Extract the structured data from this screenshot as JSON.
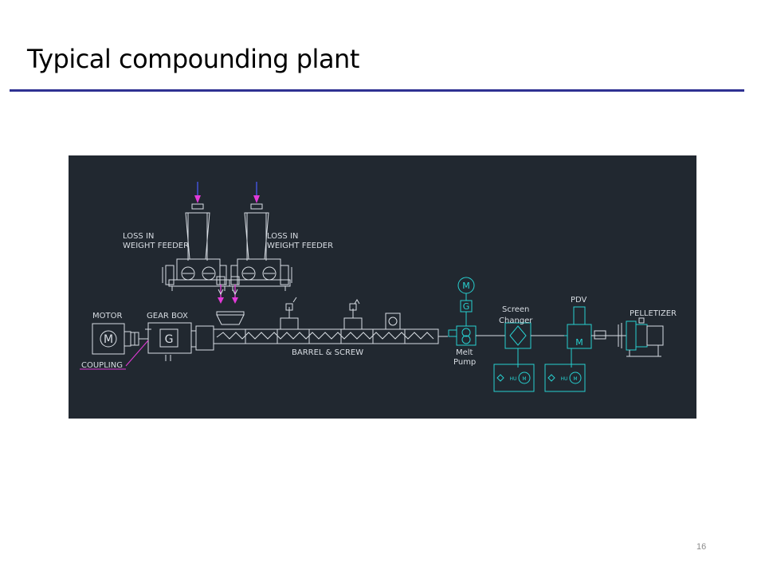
{
  "slide": {
    "title": "Typical compounding plant",
    "page_number": "16"
  },
  "diagram": {
    "labels": {
      "feeder_left": [
        "LOSS IN",
        "WEIGHT FEEDER"
      ],
      "feeder_right": [
        "LOSS IN",
        "WEIGHT FEEDER"
      ],
      "motor": "MOTOR",
      "gear_box": "GEAR BOX",
      "coupling": "COUPLING",
      "barrel_screw": "BARREL & SCREW",
      "melt_pump": [
        "Melt",
        "Pump"
      ],
      "screen_changer": [
        "Screen",
        "Changer"
      ],
      "pdv": "PDV",
      "pelletizer": "PELLETIZER"
    },
    "symbols": {
      "motor_symbol": "M",
      "gear_symbol": "G",
      "pump_motor_symbol": "M",
      "pump_gear_symbol": "G",
      "pdv_symbol": "M",
      "hu_left": "HU",
      "hu_right": "HU",
      "hu_motor_left": "M",
      "hu_motor_right": "M"
    },
    "colors": {
      "background": "#212830",
      "line_white": "#d8dde3",
      "line_cyan": "#28d0d0",
      "accent_magenta": "#e23ad8",
      "accent_blue": "#4a5cff",
      "title_rule": "#2e3192"
    }
  }
}
